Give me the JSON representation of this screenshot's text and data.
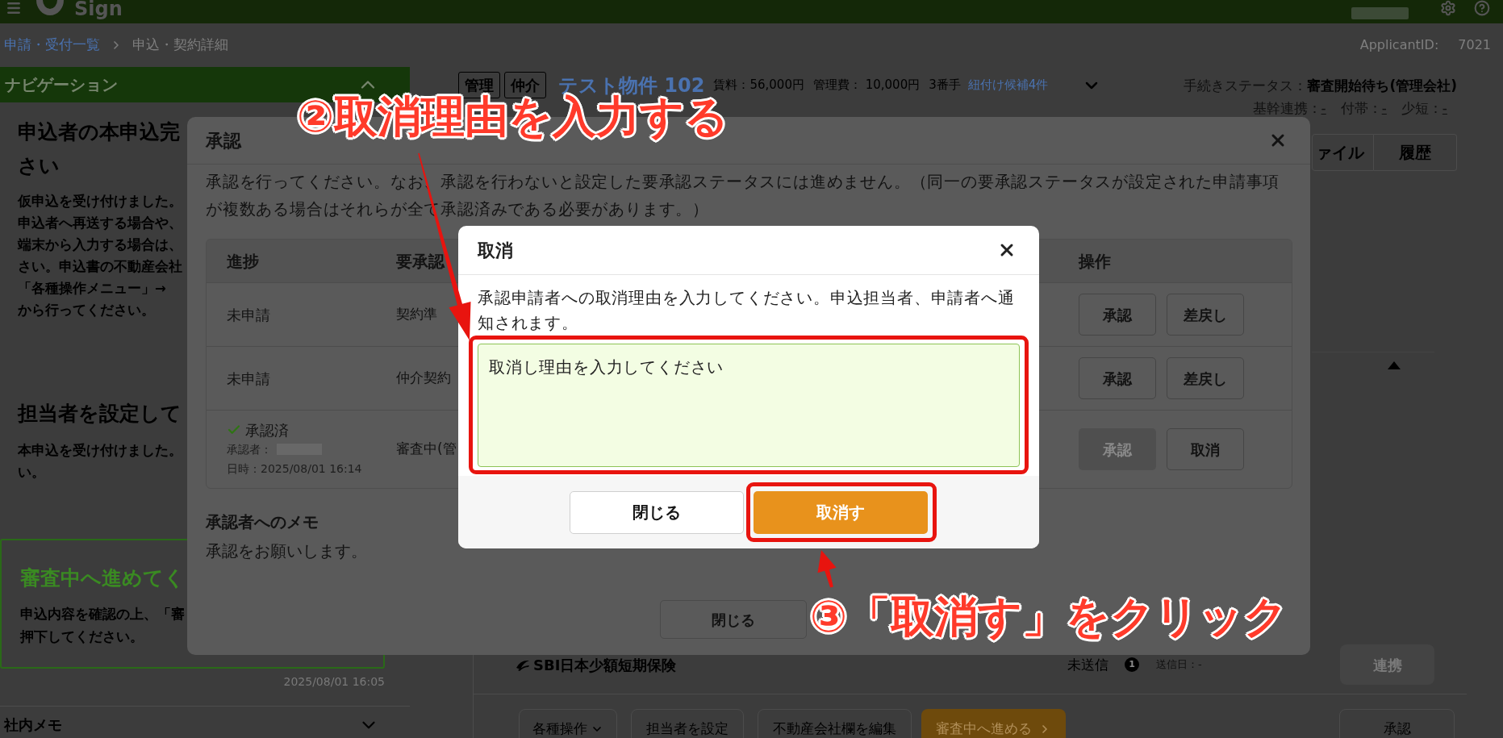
{
  "header": {
    "logo_text": "Sign"
  },
  "breadcrumb": [
    {
      "label": "申請・受付一覧",
      "kind": "link"
    },
    {
      "label": "申込・契約詳細",
      "kind": "current"
    }
  ],
  "applicant_id": {
    "label": "ApplicantID:",
    "value": "7021"
  },
  "sidebar": {
    "title": "ナビゲーション",
    "expanded": true,
    "sections": [
      {
        "heading": [
          "申込者の本申込完",
          "さい"
        ],
        "lines": [
          "仮申込を受け付けました。",
          "申込者へ再送する場合や、",
          "端末から入力する場合は、",
          "さい。申込書の不動産会社",
          "「各種操作メニュー」→",
          "から行ってください。"
        ]
      },
      {
        "heading": [
          "担当者を設定して"
        ],
        "lines": [
          "本申込を受け付けました。",
          "い。"
        ]
      }
    ],
    "action_card": {
      "title": "審査中へ進めてく",
      "lines": [
        "申込内容を確認の上、「審",
        "押下してください。"
      ]
    },
    "timestamp": "2025/08/01 16:05",
    "memo": {
      "title": "社内メモ",
      "expanded": false
    }
  },
  "property": {
    "tags": [
      "管理",
      "仲介"
    ],
    "name": "テスト物件 102",
    "details": [
      "賃料：56,000円",
      "管理費： 10,000円",
      "3番手"
    ],
    "candidates_link": "紐付け候補4件",
    "expanded": false
  },
  "procedure_status": {
    "label": "手続きステータス：",
    "value": "審査開始待ち(管理会社)",
    "integrations": [
      {
        "label": "基幹連携：",
        "value": "-"
      },
      {
        "label": "付帯：",
        "value": "-"
      },
      {
        "label": "少短：",
        "value": "-"
      }
    ]
  },
  "tabs": [
    {
      "label": "ァイル",
      "selected": false
    },
    {
      "label": "履歴",
      "selected": false
    }
  ],
  "insurance": {
    "name": "SBI日本少額短期保険",
    "status": "未送信",
    "badge": "1",
    "sent_date": "送信日：-",
    "button": {
      "label": "連携",
      "disabled": true
    }
  },
  "actions": [
    {
      "label": "各種操作",
      "kind": "menu"
    },
    {
      "label": "担当者を設定",
      "kind": "default"
    },
    {
      "label": "不動産会社欄を編集",
      "kind": "default"
    },
    {
      "label": "審査中へ進める",
      "kind": "primary"
    }
  ],
  "approve_button": "承認",
  "approval_dialog": {
    "title": "承認",
    "description": "承認を行ってください。なお、承認を行わないと設定した要承認ステータスには進めません。（同一の要承認ステータスが設定された申請事項が複数ある場合はそれらが全て承認済みである必要があります。）",
    "columns": [
      "進捗",
      "要承認",
      "操作"
    ],
    "rows": [
      {
        "progress": {
          "kind": "pending",
          "label": "未申請"
        },
        "status": "契約準",
        "buttons": [
          {
            "label": "承認",
            "disabled": false
          },
          {
            "label": "差戻し",
            "disabled": false
          }
        ]
      },
      {
        "progress": {
          "kind": "pending",
          "label": "未申請"
        },
        "status": "仲介契約",
        "buttons": [
          {
            "label": "承認",
            "disabled": false
          },
          {
            "label": "差戻し",
            "disabled": false
          }
        ]
      },
      {
        "progress": {
          "kind": "approved",
          "label": "承認済",
          "approver": "承認者：",
          "date": "日時：2025/08/01 16:14"
        },
        "status": "審査中(管",
        "buttons": [
          {
            "label": "承認",
            "disabled": true
          },
          {
            "label": "取消",
            "disabled": false
          }
        ]
      }
    ],
    "memo_title": "承認者へのメモ",
    "memo": "承認をお願いします。",
    "close_button": "閉じる"
  },
  "cancel_dialog": {
    "title": "取消",
    "description": "承認申請者への取消理由を入力してください。申込担当者、申請者へ通知されます。",
    "reason": "取消し理由を入力してください",
    "buttons": [
      {
        "label": "閉じる",
        "kind": "secondary"
      },
      {
        "label": "取消す",
        "kind": "primary"
      }
    ]
  },
  "annotations": [
    {
      "label": "②取消理由を入力する"
    },
    {
      "label": "③「取消す」をクリック"
    }
  ]
}
